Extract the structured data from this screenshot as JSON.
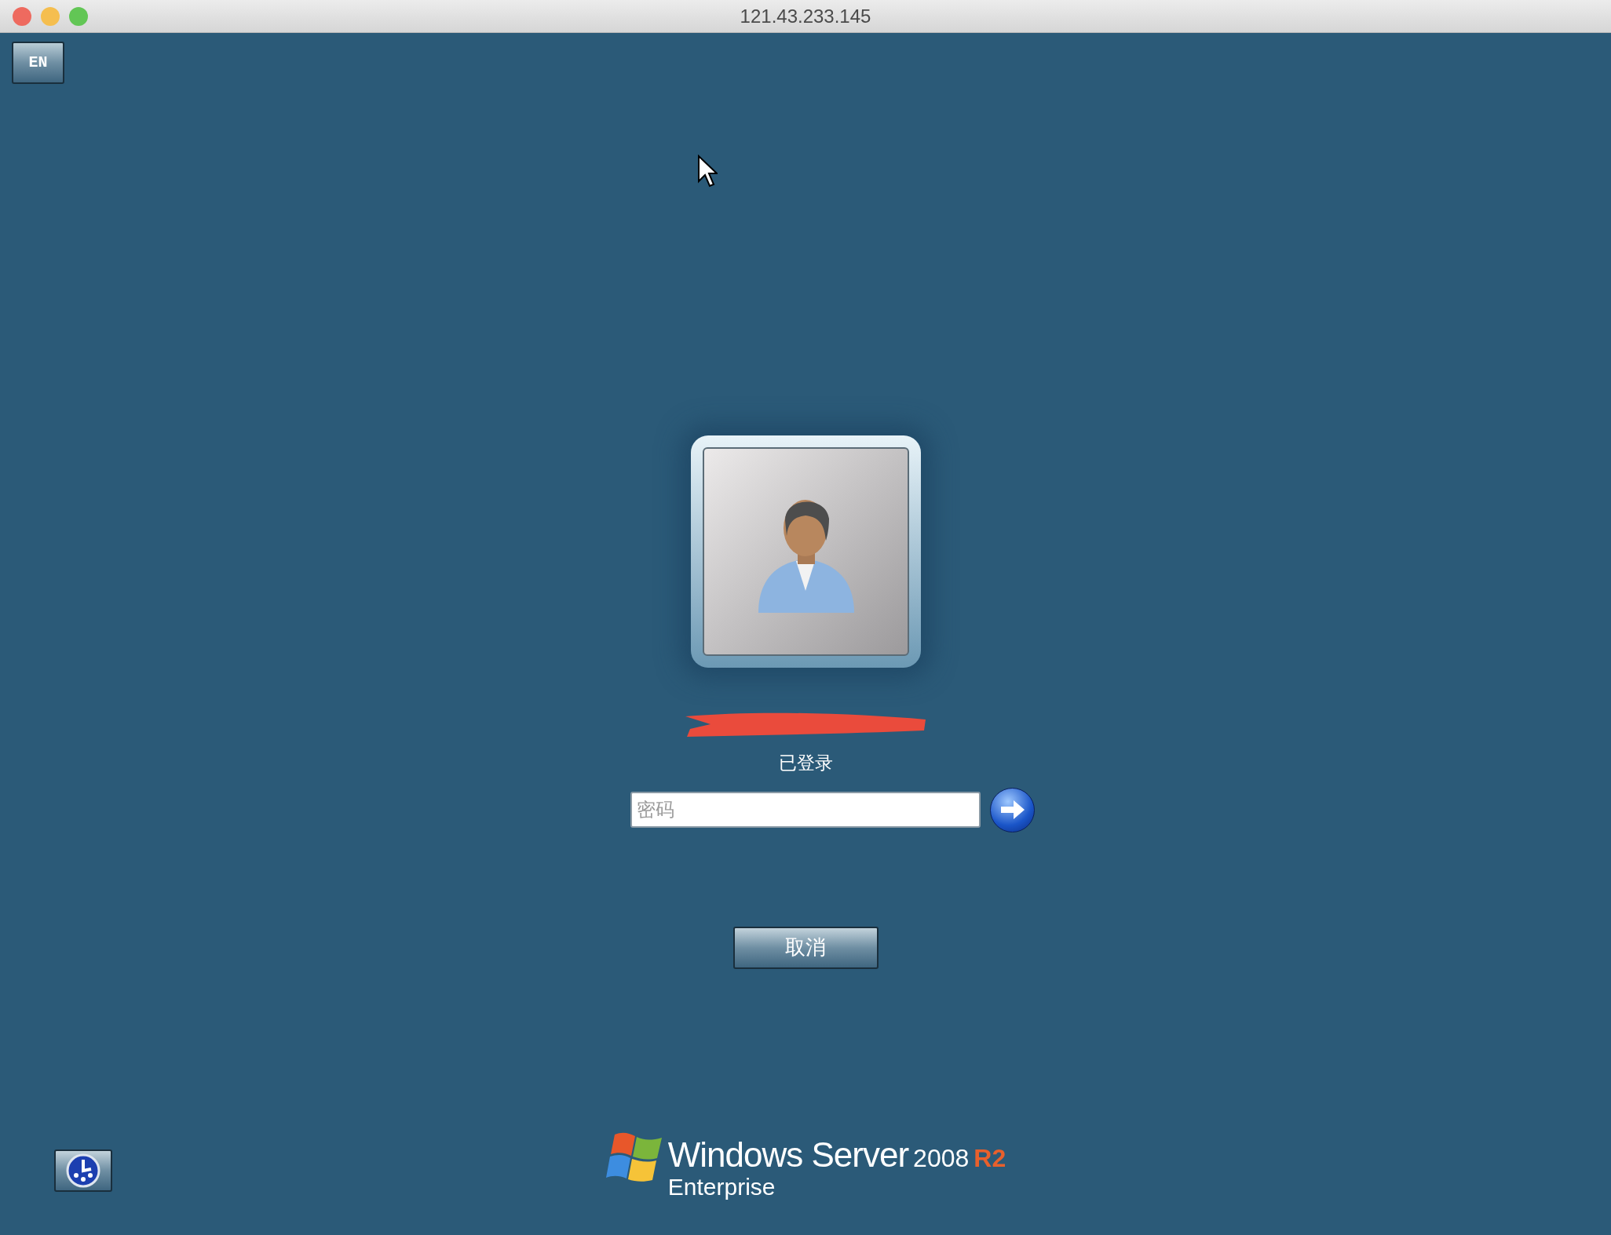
{
  "window": {
    "title": "121.43.233.145",
    "controls": [
      {
        "color": "#ee6a5f"
      },
      {
        "color": "#f5be4f"
      },
      {
        "color": "#62c655"
      }
    ]
  },
  "language_button": "EN",
  "user": {
    "name_redacted": true,
    "status": "已登录"
  },
  "password_field": {
    "placeholder": "密码"
  },
  "cancel_button": "取消",
  "logo": {
    "product": "Windows Server",
    "version": "2008",
    "release": "R2",
    "edition": "Enterprise"
  }
}
